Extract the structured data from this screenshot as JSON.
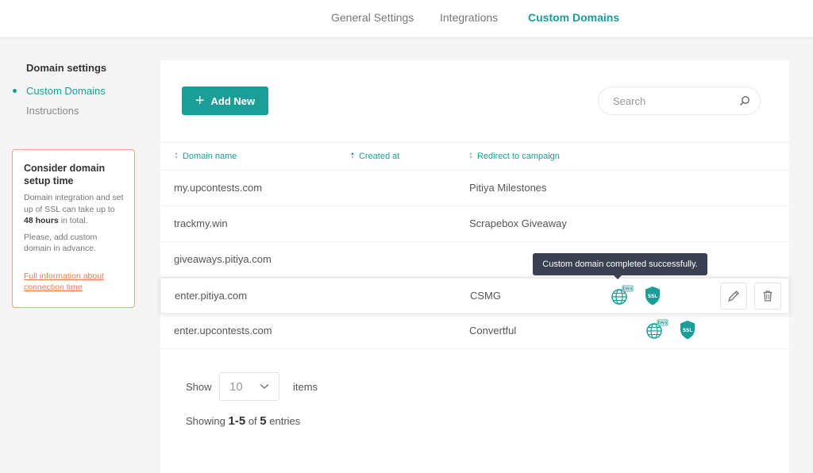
{
  "top_tabs": [
    {
      "label": "General Settings",
      "active": false
    },
    {
      "label": "Integrations",
      "active": false
    },
    {
      "label": "Custom Domains",
      "active": true
    }
  ],
  "sidebar": {
    "title": "Domain settings",
    "items": [
      {
        "label": "Custom Domains",
        "active": true
      },
      {
        "label": "Instructions",
        "active": false
      }
    ]
  },
  "notice": {
    "title": "Consider domain setup time",
    "text_before": "Domain integration and set up of SSL can take up to",
    "text_bold": "48 hours",
    "text_after": "in total.",
    "text2": "Please, add custom domain in advance.",
    "link": "Full information about connection time"
  },
  "toolbar": {
    "add_label": "Add New",
    "search_placeholder": "Search"
  },
  "table": {
    "columns": [
      "Domain name",
      "Created at",
      "Redirect to campaign"
    ],
    "rows": [
      {
        "domain": "my.upcontests.com",
        "campaign": "Pitiya Milestones"
      },
      {
        "domain": "trackmy.win",
        "campaign": "Scrapebox Giveaway"
      },
      {
        "domain": "giveaways.pitiya.com",
        "campaign": ""
      },
      {
        "domain": "enter.pitiya.com",
        "campaign": "CSMG"
      },
      {
        "domain": "enter.upcontests.com",
        "campaign": "Convertful"
      }
    ],
    "dns_icon_label": "DNS",
    "ssl_icon_label": "SSL"
  },
  "tooltip": "Custom domain completed successfully.",
  "pagination": {
    "show_label": "Show",
    "page_size": "10",
    "items_label": "items",
    "showing": "Showing",
    "range": "1-5",
    "of": "of",
    "total": "5",
    "entries": "entries"
  },
  "colors": {
    "accent": "#1a9e97",
    "notice_border": "#f0a27d",
    "link": "#f07a4a",
    "tooltip_bg": "#3b4150"
  }
}
